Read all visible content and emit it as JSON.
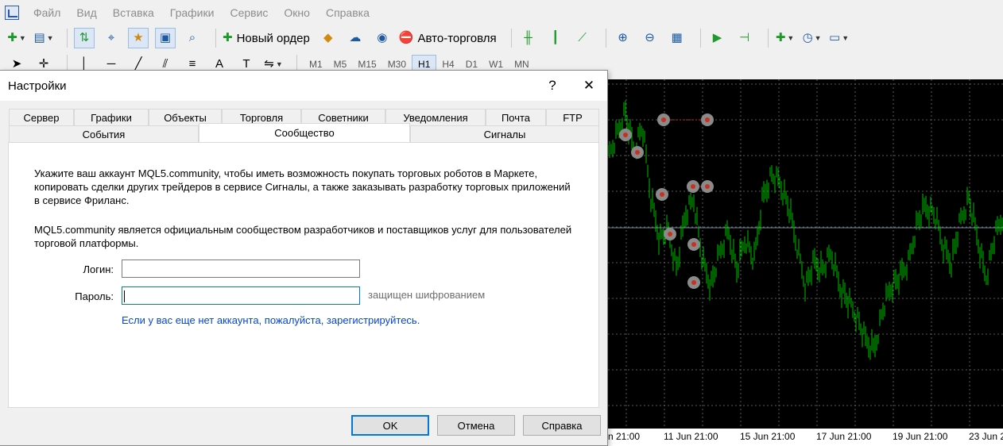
{
  "menubar": {
    "items": [
      "Файл",
      "Вид",
      "Вставка",
      "Графики",
      "Сервис",
      "Окно",
      "Справка"
    ]
  },
  "toolbar": {
    "new_order_label": "Новый ордер",
    "autotrading_label": "Авто-торговля",
    "timeframes": [
      "M1",
      "M5",
      "M15",
      "M30",
      "H1",
      "H4",
      "D1",
      "W1",
      "MN"
    ],
    "active_timeframe": "H1"
  },
  "dialog": {
    "title": "Настройки",
    "help_glyph": "?",
    "close_glyph": "✕",
    "tabs_row1": [
      "Сервер",
      "Графики",
      "Объекты",
      "Торговля",
      "Советники",
      "Уведомления",
      "Почта",
      "FTP"
    ],
    "tabs_row2": [
      "События",
      "Сообщество",
      "Сигналы"
    ],
    "selected_tab": "Сообщество",
    "paragraph1": "Укажите ваш аккаунт MQL5.community, чтобы иметь возможность покупать торговых роботов в Маркете, копировать сделки других трейдеров в сервисе Сигналы, а также заказывать разработку торговых приложений в сервисе Фриланс.",
    "paragraph2": "MQL5.community является официальным сообществом разработчиков и поставщиков услуг для пользователей торговой платформы.",
    "login_label": "Логин:",
    "login_value": "",
    "password_label": "Пароль:",
    "password_value": "",
    "encrypted_hint": "защищен шифрованием",
    "register_link": "Если у вас еще нет аккаунта, пожалуйста, зарегистрируйтесь.",
    "ok_label": "OK",
    "cancel_label": "Отмена",
    "help_label": "Справка"
  },
  "chart": {
    "background": "#000000",
    "bar_color": "#00c000",
    "grid_color": "#5a5a5a",
    "date_labels": [
      "n 21:00",
      "11 Jun 21:00",
      "15 Jun 21:00",
      "17 Jun 21:00",
      "19 Jun 21:00",
      "23 Jun 2"
    ]
  }
}
